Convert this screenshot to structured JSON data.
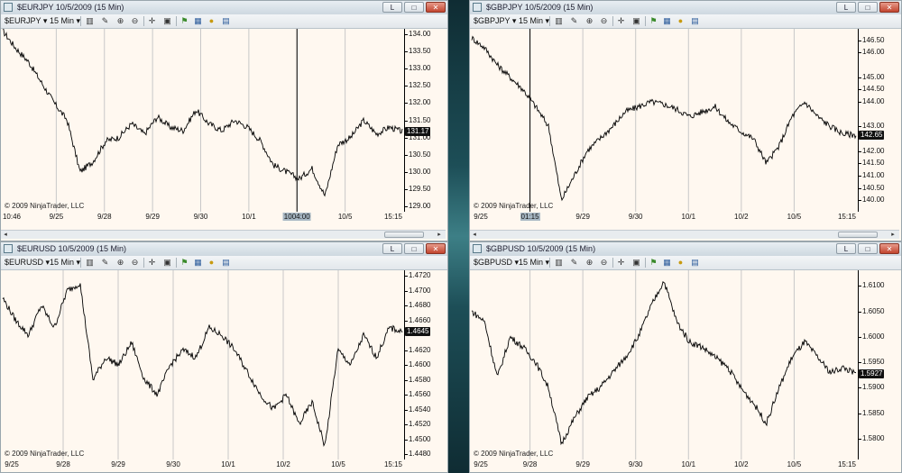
{
  "charts": [
    {
      "id": "eurjpy",
      "title": "$EURJPY  10/5/2009 (15 Min)",
      "instrument": "$EURJPY",
      "interval": "15 Min",
      "copyright": "© 2009 NinjaTrader, LLC",
      "y_ticks": [
        "134.00",
        "133.50",
        "133.00",
        "132.50",
        "132.00",
        "131.50",
        "131.00",
        "130.50",
        "130.00",
        "129.50",
        "129.00"
      ],
      "y_min": 129.0,
      "y_max": 134.0,
      "last_value": "131.17",
      "x_labels": [
        "10:46",
        "9/25",
        "9/28",
        "9/29",
        "9/30",
        "10/1",
        "1004:00",
        "10/5",
        "15:15"
      ],
      "highlight_x_label": "1004:00",
      "chart_data": {
        "type": "line",
        "title": "",
        "xlabel": "",
        "ylabel": "",
        "ylim": [
          129.0,
          134.0
        ],
        "x": [
          "10:46",
          "9/25",
          "9/28",
          "9/29",
          "9/30",
          "10/1",
          "10/2",
          "10/5",
          "15:15"
        ],
        "series": [
          {
            "values": [
              134.1,
              133.6,
              133.2,
              132.6,
              132.0,
              131.5,
              130.0,
              130.3,
              130.9,
              131.0,
              131.4,
              131.1,
              131.6,
              131.3,
              131.2,
              131.8,
              131.4,
              131.2,
              131.5,
              131.3,
              130.9,
              130.2,
              130.0,
              129.8,
              130.1,
              129.3,
              130.8,
              131.0,
              131.5,
              131.1,
              131.3,
              131.17
            ]
          }
        ]
      }
    },
    {
      "id": "gbpjpy",
      "title": "$GBPJPY  10/5/2009 (15 Min)",
      "instrument": "$GBPJPY",
      "interval": "15 Min",
      "copyright": "© 2009 NinjaTrader, LLC",
      "y_ticks": [
        "146.50",
        "146.00",
        "145.00",
        "144.50",
        "144.00",
        "143.00",
        "142.00",
        "141.50",
        "141.00",
        "140.50",
        "140.00"
      ],
      "y_min": 139.75,
      "y_max": 146.75,
      "last_value": "142.65",
      "x_labels": [
        "9/25",
        "01:15",
        "9/29",
        "9/30",
        "10/1",
        "10/2",
        "10/5",
        "15:15"
      ],
      "highlight_x_label": "01:15",
      "chart_data": {
        "type": "line",
        "title": "",
        "xlabel": "",
        "ylabel": "",
        "ylim": [
          139.75,
          146.75
        ],
        "x": [
          "9/25",
          "9/28",
          "9/29",
          "9/30",
          "10/1",
          "10/2",
          "10/5",
          "15:15"
        ],
        "series": [
          {
            "values": [
              146.6,
              146.2,
              145.5,
              145.0,
              144.5,
              143.8,
              143.0,
              140.0,
              141.0,
              142.0,
              142.5,
              143.0,
              143.6,
              143.8,
              144.0,
              143.9,
              143.7,
              143.4,
              143.6,
              143.8,
              143.2,
              142.8,
              142.5,
              141.5,
              142.2,
              143.4,
              144.0,
              143.4,
              143.0,
              142.7,
              142.65
            ]
          }
        ]
      }
    },
    {
      "id": "eurusd",
      "title": "$EURUSD  10/5/2009 (15 Min)",
      "instrument": "$EURUSD",
      "interval": "15 Min",
      "copyright": "© 2009 NinjaTrader, LLC",
      "y_ticks": [
        "1.4720",
        "1.4700",
        "1.4680",
        "1.4660",
        "1.4620",
        "1.4600",
        "1.4580",
        "1.4560",
        "1.4540",
        "1.4520",
        "1.4500",
        "1.4480"
      ],
      "y_min": 1.448,
      "y_max": 1.472,
      "last_value": "1.4645",
      "x_labels": [
        "9/25",
        "9/28",
        "9/29",
        "9/30",
        "10/1",
        "10/2",
        "10/5",
        "15:15"
      ],
      "highlight_x_label": "",
      "chart_data": {
        "type": "line",
        "title": "",
        "xlabel": "",
        "ylabel": "",
        "ylim": [
          1.448,
          1.472
        ],
        "x": [
          "9/25",
          "9/28",
          "9/29",
          "9/30",
          "10/1",
          "10/2",
          "10/5",
          "15:15"
        ],
        "series": [
          {
            "values": [
              1.469,
              1.466,
              1.464,
              1.468,
              1.465,
              1.47,
              1.471,
              1.458,
              1.461,
              1.46,
              1.463,
              1.458,
              1.456,
              1.46,
              1.462,
              1.461,
              1.465,
              1.464,
              1.462,
              1.459,
              1.456,
              1.454,
              1.456,
              1.452,
              1.455,
              1.449,
              1.462,
              1.46,
              1.464,
              1.461,
              1.465,
              1.4645
            ]
          }
        ]
      }
    },
    {
      "id": "gbpusd",
      "title": "$GBPUSD  10/5/2009 (15 Min)",
      "instrument": "$GBPUSD",
      "interval": "15 Min",
      "copyright": "© 2009 NinjaTrader, LLC",
      "y_ticks": [
        "1.6100",
        "1.6050",
        "1.6000",
        "1.5950",
        "1.5900",
        "1.5850",
        "1.5800"
      ],
      "y_min": 1.577,
      "y_max": 1.612,
      "last_value": "1.5927",
      "x_labels": [
        "9/25",
        "9/28",
        "9/29",
        "9/30",
        "10/1",
        "10/2",
        "10/5",
        "15:15"
      ],
      "highlight_x_label": "",
      "chart_data": {
        "type": "line",
        "title": "",
        "xlabel": "",
        "ylabel": "",
        "ylim": [
          1.577,
          1.612
        ],
        "x": [
          "9/25",
          "9/28",
          "9/29",
          "9/30",
          "10/1",
          "10/2",
          "10/5",
          "15:15"
        ],
        "series": [
          {
            "values": [
              1.605,
              1.603,
              1.592,
              1.6,
              1.598,
              1.595,
              1.59,
              1.579,
              1.584,
              1.588,
              1.59,
              1.593,
              1.596,
              1.6,
              1.606,
              1.611,
              1.603,
              1.599,
              1.598,
              1.596,
              1.594,
              1.59,
              1.587,
              1.583,
              1.59,
              1.596,
              1.599,
              1.596,
              1.593,
              1.594,
              1.5927
            ]
          }
        ]
      }
    }
  ],
  "toolbar": {
    "instrument_dropdown_icon": "chevron-down-icon",
    "interval_dropdown_icon": "chevron-down-icon",
    "icons": [
      "bar-style-icon",
      "pencil-draw-icon",
      "zoom-in-icon",
      "zoom-out-icon",
      "crosshair-icon",
      "properties-icon",
      "strategy-icon",
      "indicator-icon",
      "coin-icon",
      "data-box-icon"
    ]
  },
  "window_buttons": {
    "restore_label": "L",
    "maximize_label": "□",
    "close_label": "✕"
  },
  "colors": {
    "plot_bg": "#fff8f0",
    "line": "#000000",
    "grid": "#c8c8c8"
  }
}
